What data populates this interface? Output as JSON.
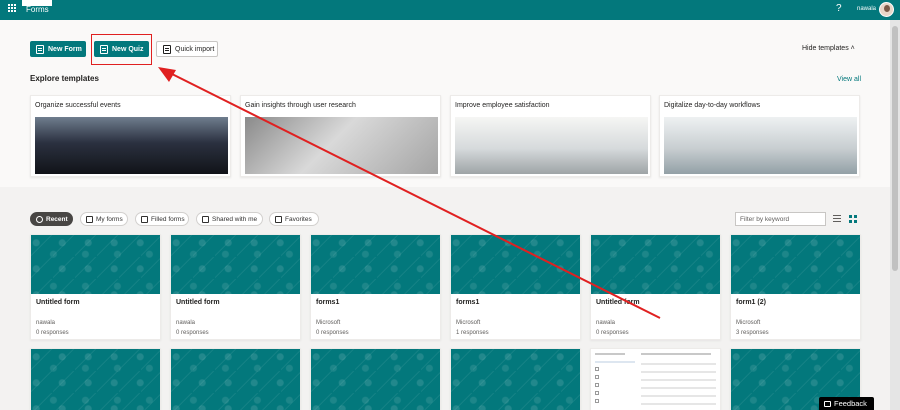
{
  "app": {
    "name": "Forms",
    "user_name": "nawala",
    "help_glyph": "?"
  },
  "toolbar": {
    "new_form": "New Form",
    "new_quiz": "New Quiz",
    "quick_import": "Quick import",
    "hide_templates": "Hide templates ˄"
  },
  "templates": {
    "heading": "Explore templates",
    "view_all": "View all",
    "items": [
      {
        "title": "Organize successful events"
      },
      {
        "title": "Gain insights through user research"
      },
      {
        "title": "Improve employee satisfaction"
      },
      {
        "title": "Digitalize day-to-day workflows"
      }
    ]
  },
  "filters": {
    "tabs": [
      "Recent",
      "My forms",
      "Filled forms",
      "Shared with me",
      "Favorites"
    ],
    "active_tab": "Recent",
    "search_placeholder": "Filter by keyword"
  },
  "forms": [
    {
      "title": "Untitled form",
      "owner": "nawala",
      "responses": "0 responses"
    },
    {
      "title": "Untitled form",
      "owner": "nawala",
      "responses": "0 responses"
    },
    {
      "title": "forms1",
      "owner": "Microsoft",
      "responses": "0 responses"
    },
    {
      "title": "forms1",
      "owner": "Microsoft",
      "responses": "1 responses"
    },
    {
      "title": "Untitled form",
      "owner": "nawala",
      "responses": "0 responses"
    },
    {
      "title": "form1 (2)",
      "owner": "Microsoft",
      "responses": "3 responses"
    }
  ],
  "feedback": {
    "label": "Feedback"
  },
  "colors": {
    "brand": "#03787c",
    "annotation": "#e02020"
  }
}
